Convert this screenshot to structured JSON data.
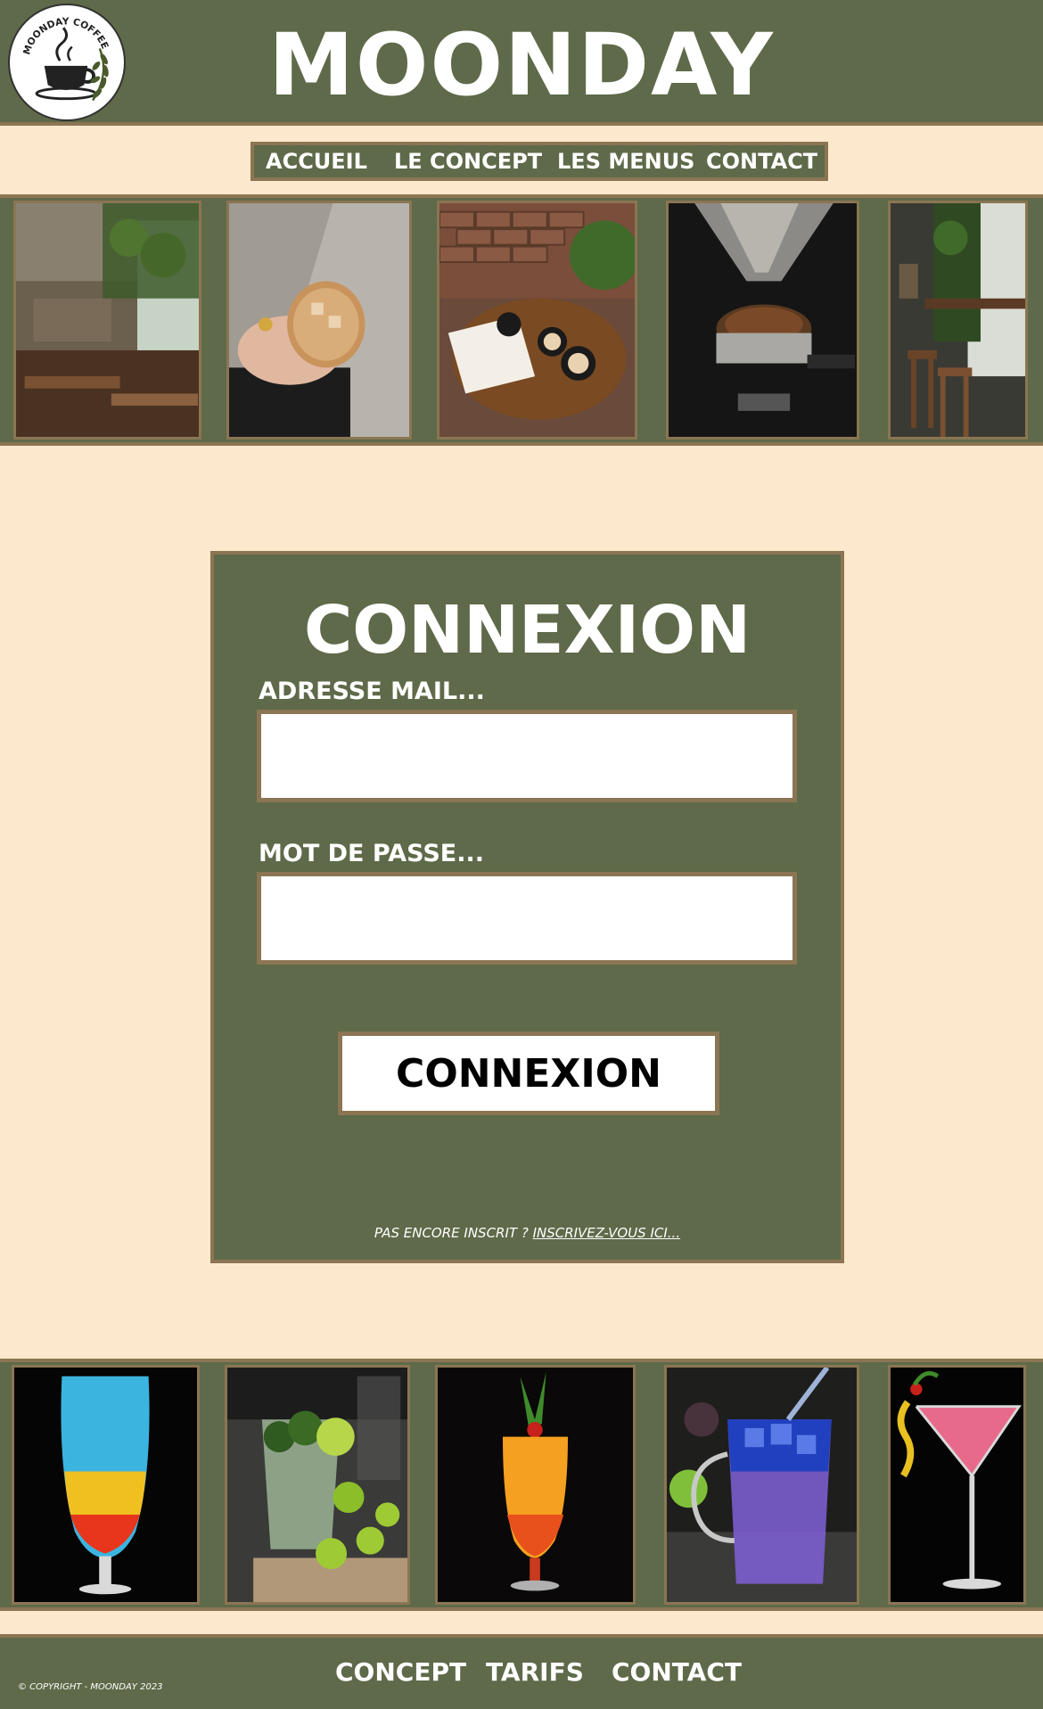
{
  "header": {
    "title": "MOONDAY",
    "logo_text": "MOONDAY COFFEE"
  },
  "nav": {
    "items": [
      {
        "label": "ACCUEIL"
      },
      {
        "label": "LE CONCEPT"
      },
      {
        "label": "LES MENUS"
      },
      {
        "label": "CONTACT"
      }
    ]
  },
  "gallery_top": {
    "photos": [
      {
        "subject": "restaurant-interior"
      },
      {
        "subject": "iced-coffee-in-hand"
      },
      {
        "subject": "coffee-table-with-book"
      },
      {
        "subject": "espresso-grinder"
      },
      {
        "subject": "bar-stools-by-window"
      }
    ]
  },
  "login": {
    "title": "CONNEXION",
    "email_label": "ADRESSE MAIL...",
    "email_value": "",
    "password_label": "MOT DE PASSE...",
    "password_value": "",
    "submit_label": "CONNEXION",
    "signup_prompt": "PAS ENCORE INSCRIT ?",
    "signup_link": "INSCRIVEZ-VOUS ICI..."
  },
  "gallery_bottom": {
    "photos": [
      {
        "subject": "layered-blue-cocktail"
      },
      {
        "subject": "mojito-with-limes"
      },
      {
        "subject": "orange-tropical-cocktail"
      },
      {
        "subject": "blue-purple-iced-drink"
      },
      {
        "subject": "pink-martini"
      }
    ]
  },
  "footer": {
    "copyright": "© COPYRIGHT - MOONDAY 2023",
    "links": [
      {
        "label": "CONCEPT"
      },
      {
        "label": "TARIFS"
      },
      {
        "label": "CONTACT"
      }
    ]
  },
  "colors": {
    "background": "#fce8cc",
    "panel_green": "#5e6a49",
    "border_brown": "#8b7553",
    "text_white": "#ffffff"
  }
}
